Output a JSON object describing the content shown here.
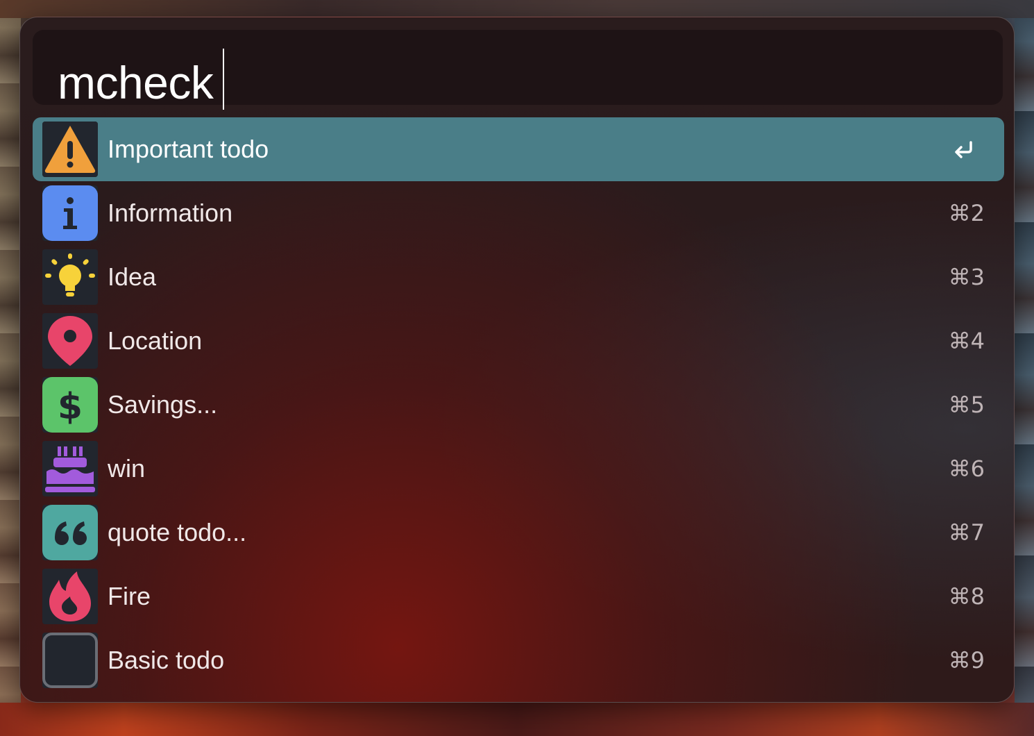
{
  "search": {
    "query": "mcheck"
  },
  "results": [
    {
      "label": "Important todo",
      "icon": "warning-icon",
      "shortcut": "↩",
      "selected": true
    },
    {
      "label": "Information",
      "icon": "info-icon",
      "shortcut": "⌘2",
      "selected": false
    },
    {
      "label": "Idea",
      "icon": "lightbulb-icon",
      "shortcut": "⌘3",
      "selected": false
    },
    {
      "label": "Location",
      "icon": "map-pin-icon",
      "shortcut": "⌘4",
      "selected": false
    },
    {
      "label": "Savings...",
      "icon": "dollar-icon",
      "shortcut": "⌘5",
      "selected": false
    },
    {
      "label": "win",
      "icon": "cake-icon",
      "shortcut": "⌘6",
      "selected": false
    },
    {
      "label": "quote todo...",
      "icon": "quote-icon",
      "shortcut": "⌘7",
      "selected": false
    },
    {
      "label": "Fire",
      "icon": "fire-icon",
      "shortcut": "⌘8",
      "selected": false
    },
    {
      "label": "Basic todo",
      "icon": "empty-square-icon",
      "shortcut": "⌘9",
      "selected": false
    }
  ],
  "colors": {
    "selected_row": "#4a7e88",
    "warning": "#f0a03c",
    "info": "#5b8cf0",
    "idea": "#f7d23a",
    "location": "#e8456a",
    "savings": "#5cc46a",
    "win": "#a25bdc",
    "quote": "#4fa8a0",
    "fire": "#e8456a"
  }
}
